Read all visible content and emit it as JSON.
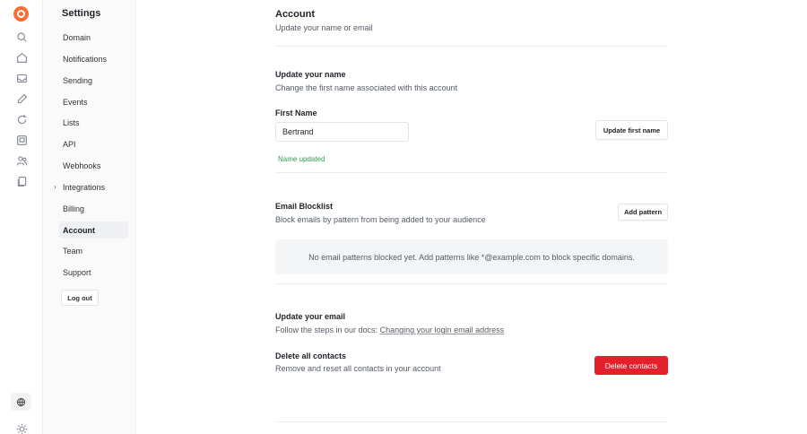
{
  "sidebar": {
    "title": "Settings",
    "items": [
      {
        "label": "Domain"
      },
      {
        "label": "Notifications"
      },
      {
        "label": "Sending"
      },
      {
        "label": "Events"
      },
      {
        "label": "Lists"
      },
      {
        "label": "API"
      },
      {
        "label": "Webhooks"
      },
      {
        "label": "Integrations"
      },
      {
        "label": "Billing"
      },
      {
        "label": "Account"
      },
      {
        "label": "Team"
      },
      {
        "label": "Support"
      }
    ],
    "active_item": "Account",
    "logout_label": "Log out"
  },
  "rail": {
    "icons": [
      "logo-icon",
      "search-icon",
      "home-icon",
      "inbox-icon",
      "compose-icon",
      "refresh-icon",
      "template-icon",
      "users-icon",
      "files-icon",
      "globe-icon",
      "sun-icon"
    ]
  },
  "header": {
    "title": "Account",
    "subtitle": "Update your name or email"
  },
  "name_section": {
    "title": "Update your name",
    "subtitle": "Change the first name associated with this account",
    "field_label": "First Name",
    "field_value": "Bertrand",
    "button_label": "Update first name",
    "status": "Name updated"
  },
  "blocklist": {
    "title": "Email Blocklist",
    "subtitle": "Block emails by pattern from being added to your audience",
    "button_label": "Add pattern",
    "empty_text": "No email patterns blocked yet. Add patterns like *@example.com to block specific domains."
  },
  "email_section": {
    "title": "Update your email",
    "text": "Follow the steps in our docs:",
    "link_label": "Changing your login email address"
  },
  "delete_section": {
    "title": "Delete all contacts",
    "subtitle": "Remove and reset all contacts in your account",
    "button_label": "Delete contacts"
  },
  "colors": {
    "accent": "#ff6b35",
    "danger": "#e5202b",
    "success": "#2e9e50"
  }
}
